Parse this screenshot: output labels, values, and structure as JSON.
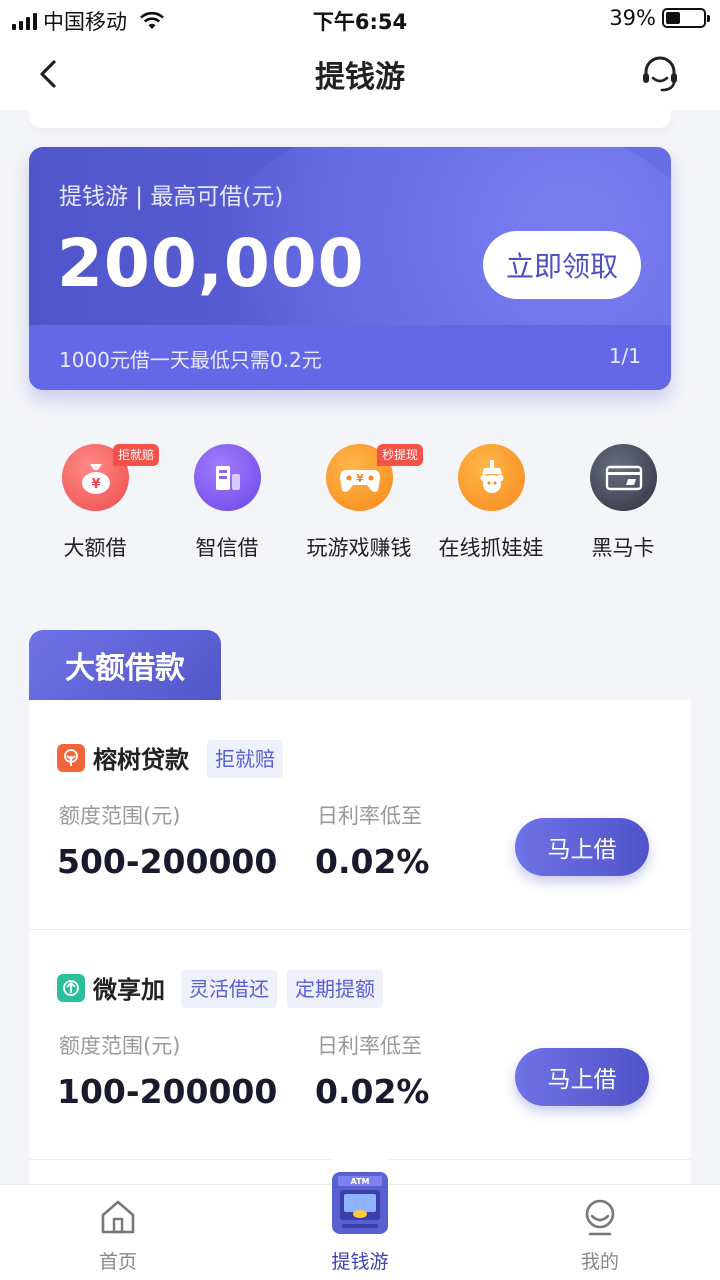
{
  "status_bar": {
    "carrier": "中国移动",
    "time": "下午6:54",
    "battery": "39%"
  },
  "header": {
    "title": "提钱游"
  },
  "hero": {
    "label": "提钱游 | 最高可借(元)",
    "amount": "200,000",
    "button": "立即领取",
    "note": "1000元借一天最低只需0.2元",
    "pager": "1/1"
  },
  "shortcuts": [
    {
      "label": "大额借",
      "badge": "拒就赔",
      "icon": "money-bag-icon"
    },
    {
      "label": "智信借",
      "badge": "",
      "icon": "building-icon"
    },
    {
      "label": "玩游戏赚钱",
      "badge": "秒提现",
      "icon": "gamepad-icon"
    },
    {
      "label": "在线抓娃娃",
      "badge": "",
      "icon": "claw-machine-icon"
    },
    {
      "label": "黑马卡",
      "badge": "",
      "icon": "card-icon"
    }
  ],
  "section": {
    "title": "大额借款"
  },
  "loans": [
    {
      "name": "榕树贷款",
      "tags": [
        "拒就赔"
      ],
      "range_label": "额度范围(元)",
      "range": "500-200000",
      "rate_label": "日利率低至",
      "rate": "0.02%",
      "button": "马上借",
      "logo_color": "#f0663a"
    },
    {
      "name": "微享加",
      "tags": [
        "灵活借还",
        "定期提额"
      ],
      "range_label": "额度范围(元)",
      "range": "100-200000",
      "rate_label": "日利率低至",
      "rate": "0.02%",
      "button": "马上借",
      "logo_color": "#2bbf9c"
    }
  ],
  "tabbar": {
    "items": [
      {
        "label": "首页",
        "icon": "home-icon"
      },
      {
        "label": "提钱游",
        "icon": "atm-icon"
      },
      {
        "label": "我的",
        "icon": "profile-icon"
      }
    ]
  },
  "colors": {
    "accent": "#5a5fd0",
    "hero_bg": "#5d61d9",
    "badge_red": "#f25248"
  }
}
